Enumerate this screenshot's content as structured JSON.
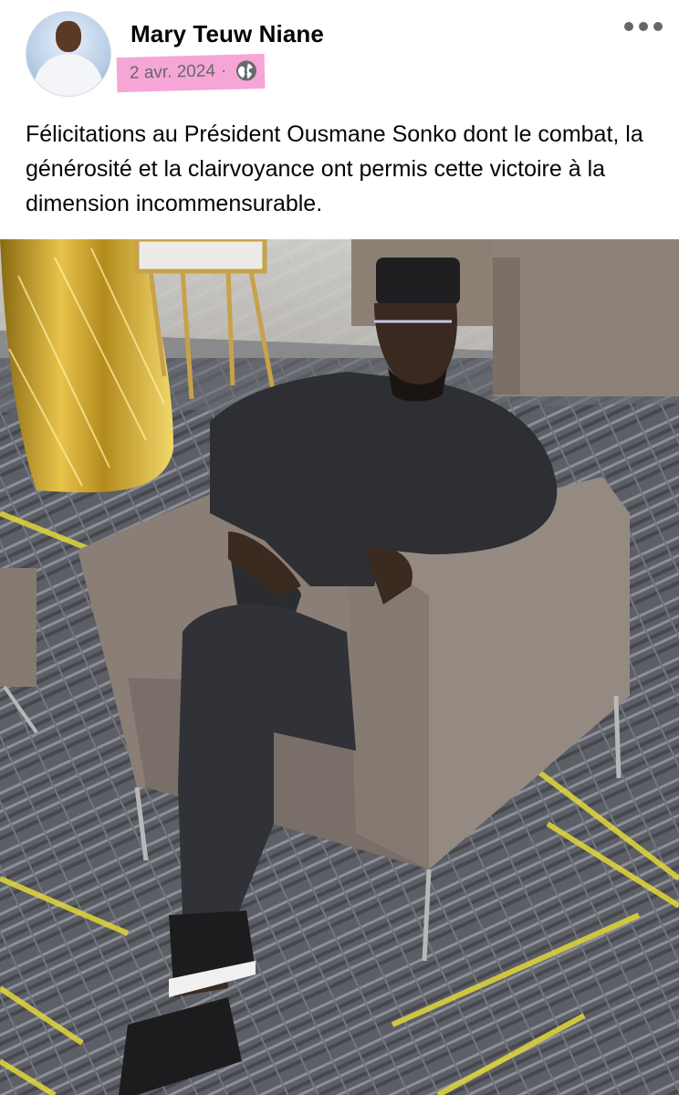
{
  "post": {
    "author": "Mary Teuw Niane",
    "date": "2 avr. 2024",
    "separator": "·",
    "privacy_icon": "globe-icon",
    "more_icon": "more-horizontal-icon",
    "text": "Félicitations au Président Ousmane Sonko dont le combat, la générosité et la clairvoyance ont permis cette victoire à la dimension incommensurable."
  },
  "colors": {
    "highlight": "#f5a6d6",
    "secondary_text": "#65676b",
    "primary_text": "#050505"
  }
}
